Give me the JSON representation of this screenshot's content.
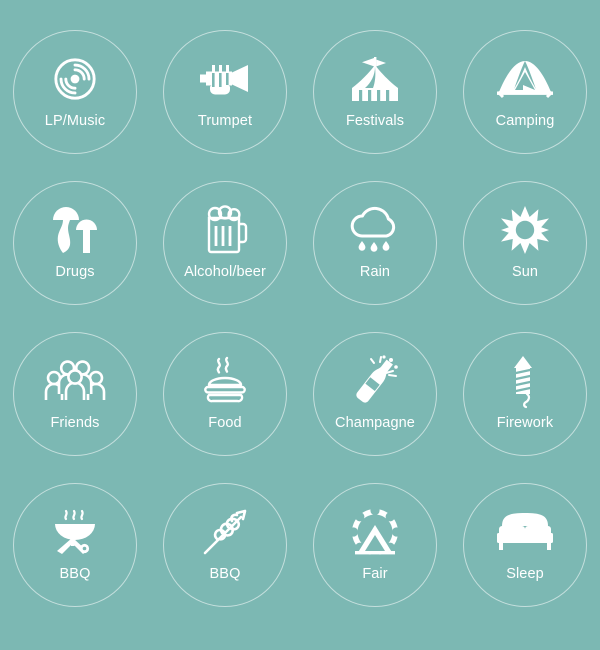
{
  "page": {
    "background_color": "#7cb8b3",
    "foreground_color": "#ffffff",
    "circle_border_color": "rgba(255,255,255,0.55)",
    "columns": 4,
    "rows": 4
  },
  "icons": [
    {
      "label": "LP/Music",
      "icon": "vinyl-record-icon"
    },
    {
      "label": "Trumpet",
      "icon": "trumpet-icon"
    },
    {
      "label": "Festivals",
      "icon": "circus-tent-icon"
    },
    {
      "label": "Camping",
      "icon": "camping-tent-icon"
    },
    {
      "label": "Drugs",
      "icon": "mushrooms-icon"
    },
    {
      "label": "Alcohol/beer",
      "icon": "beer-mug-icon"
    },
    {
      "label": "Rain",
      "icon": "rain-cloud-icon"
    },
    {
      "label": "Sun",
      "icon": "sun-icon"
    },
    {
      "label": "Friends",
      "icon": "people-group-icon"
    },
    {
      "label": "Food",
      "icon": "burger-icon"
    },
    {
      "label": "Champagne",
      "icon": "champagne-bottle-icon"
    },
    {
      "label": "Firework",
      "icon": "firework-rocket-icon"
    },
    {
      "label": "BBQ",
      "icon": "bbq-grill-icon"
    },
    {
      "label": "BBQ",
      "icon": "food-skewer-icon"
    },
    {
      "label": "Fair",
      "icon": "ferris-wheel-icon"
    },
    {
      "label": "Sleep",
      "icon": "bed-icon"
    }
  ]
}
